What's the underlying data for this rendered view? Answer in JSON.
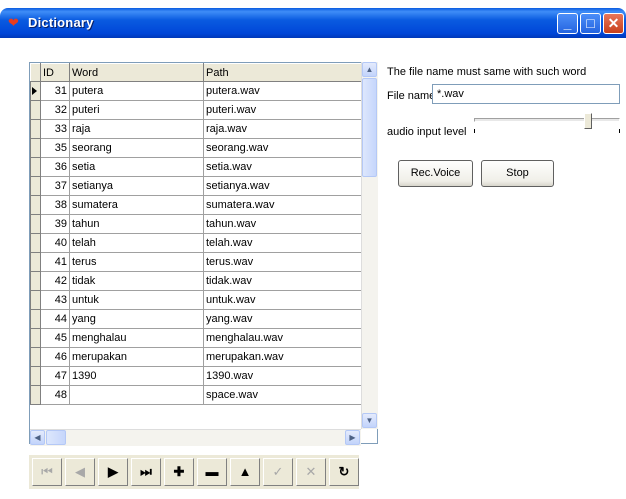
{
  "window": {
    "title": "Dictionary"
  },
  "grid": {
    "columns": [
      "ID",
      "Word",
      "Path"
    ],
    "rows": [
      {
        "id": "31",
        "word": "putera",
        "path": "putera.wav"
      },
      {
        "id": "32",
        "word": "puteri",
        "path": "puteri.wav"
      },
      {
        "id": "33",
        "word": "raja",
        "path": "raja.wav"
      },
      {
        "id": "35",
        "word": "seorang",
        "path": "seorang.wav"
      },
      {
        "id": "36",
        "word": "setia",
        "path": "setia.wav"
      },
      {
        "id": "37",
        "word": "setianya",
        "path": "setianya.wav"
      },
      {
        "id": "38",
        "word": "sumatera",
        "path": "sumatera.wav"
      },
      {
        "id": "39",
        "word": "tahun",
        "path": "tahun.wav"
      },
      {
        "id": "40",
        "word": "telah",
        "path": "telah.wav"
      },
      {
        "id": "41",
        "word": "terus",
        "path": "terus.wav"
      },
      {
        "id": "42",
        "word": "tidak",
        "path": "tidak.wav"
      },
      {
        "id": "43",
        "word": "untuk",
        "path": "untuk.wav"
      },
      {
        "id": "44",
        "word": "yang",
        "path": "yang.wav"
      },
      {
        "id": "45",
        "word": "menghalau",
        "path": "menghalau.wav"
      },
      {
        "id": "46",
        "word": "merupakan",
        "path": "merupakan.wav"
      },
      {
        "id": "47",
        "word": "1390",
        "path": "1390.wav"
      },
      {
        "id": "48",
        "word": "",
        "path": "space.wav"
      }
    ]
  },
  "navigator": {
    "buttons": [
      {
        "name": "first-record-button",
        "glyph": "⏮",
        "enabled": false
      },
      {
        "name": "prior-record-button",
        "glyph": "◀",
        "enabled": false
      },
      {
        "name": "next-record-button",
        "glyph": "▶",
        "enabled": true
      },
      {
        "name": "last-record-button",
        "glyph": "⏭",
        "enabled": true
      },
      {
        "name": "insert-record-button",
        "glyph": "✚",
        "enabled": true
      },
      {
        "name": "delete-record-button",
        "glyph": "▬",
        "enabled": true
      },
      {
        "name": "edit-record-button",
        "glyph": "▲",
        "enabled": true
      },
      {
        "name": "post-record-button",
        "glyph": "✓",
        "enabled": false
      },
      {
        "name": "cancel-record-button",
        "glyph": "✕",
        "enabled": false
      },
      {
        "name": "refresh-record-button",
        "glyph": "↻",
        "enabled": true
      }
    ]
  },
  "panel": {
    "note": "The file name must same with such word",
    "file_label": "File name:",
    "file_value": "*.wav",
    "audio_label": "audio input level",
    "audio_level": 0.8,
    "rec_label": "Rec.Voice",
    "stop_label": "Stop"
  },
  "colors": {
    "titlebar": "#0a5be0",
    "face": "#ece9d8"
  }
}
